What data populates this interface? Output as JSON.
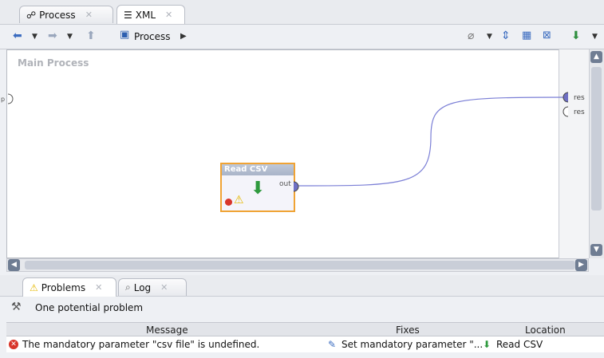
{
  "tabs": [
    {
      "label": "Process",
      "icon": "process-icon"
    },
    {
      "label": "XML",
      "icon": "xml-icon"
    }
  ],
  "toolbar": {
    "breadcrumb_label": "Process"
  },
  "canvas": {
    "title": "Main Process",
    "ports_right": [
      "res",
      "res"
    ],
    "operator": {
      "title": "Read CSV",
      "port_out": "out"
    }
  },
  "bottom_tabs": [
    {
      "label": "Problems",
      "icon": "warning-icon"
    },
    {
      "label": "Log",
      "icon": "log-icon"
    }
  ],
  "problems": {
    "summary": "One potential problem",
    "columns": [
      "Message",
      "Fixes",
      "Location"
    ],
    "rows": [
      {
        "message": "The mandatory parameter \"csv file\" is undefined.",
        "fix": "Set mandatory parameter \"...",
        "location": "Read CSV"
      }
    ]
  },
  "colors": {
    "accent": "#3b6cc0",
    "operator_border": "#f0a334",
    "connection": "#7b7fd6"
  }
}
